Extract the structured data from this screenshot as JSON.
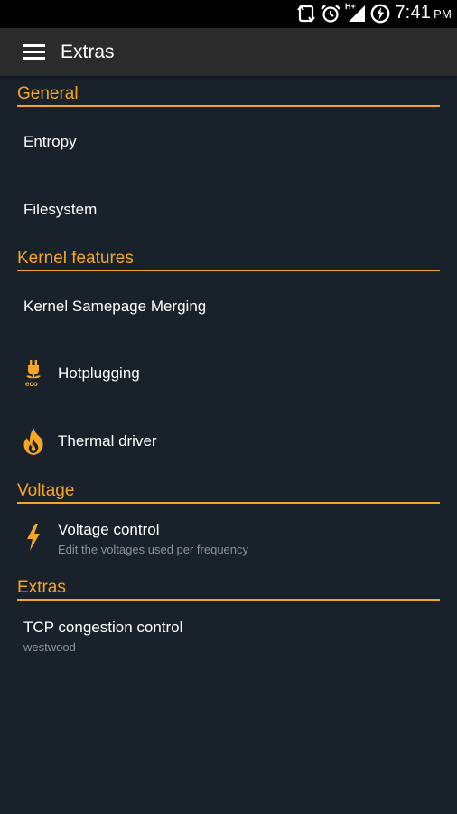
{
  "status_bar": {
    "time": "7:41",
    "ampm": "PM",
    "network_label": "H+",
    "icons": [
      "rotate-icon",
      "alarm-icon",
      "signal-icon",
      "battery-charging-icon"
    ]
  },
  "appbar": {
    "title": "Extras",
    "menu_icon": "hamburger-menu-icon"
  },
  "colors": {
    "accent": "#f5a623",
    "background": "#19222a",
    "appbar": "#2b2b2b",
    "summary_text": "#8b9298"
  },
  "sections": {
    "general": {
      "header": "General",
      "items": [
        {
          "label": "Entropy"
        },
        {
          "label": "Filesystem"
        }
      ]
    },
    "kernel_features": {
      "header": "Kernel features",
      "items": [
        {
          "label": "Kernel Samepage Merging"
        },
        {
          "label": "Hotplugging",
          "icon": "eco-plug-icon",
          "icon_text": "eco"
        },
        {
          "label": "Thermal driver",
          "icon": "flame-icon"
        }
      ]
    },
    "voltage": {
      "header": "Voltage",
      "items": [
        {
          "label": "Voltage control",
          "summary": "Edit the voltages used per frequency",
          "icon": "lightning-bolt-icon"
        }
      ]
    },
    "extras": {
      "header": "Extras",
      "items": [
        {
          "label": "TCP congestion control",
          "summary": "westwood"
        }
      ]
    }
  }
}
